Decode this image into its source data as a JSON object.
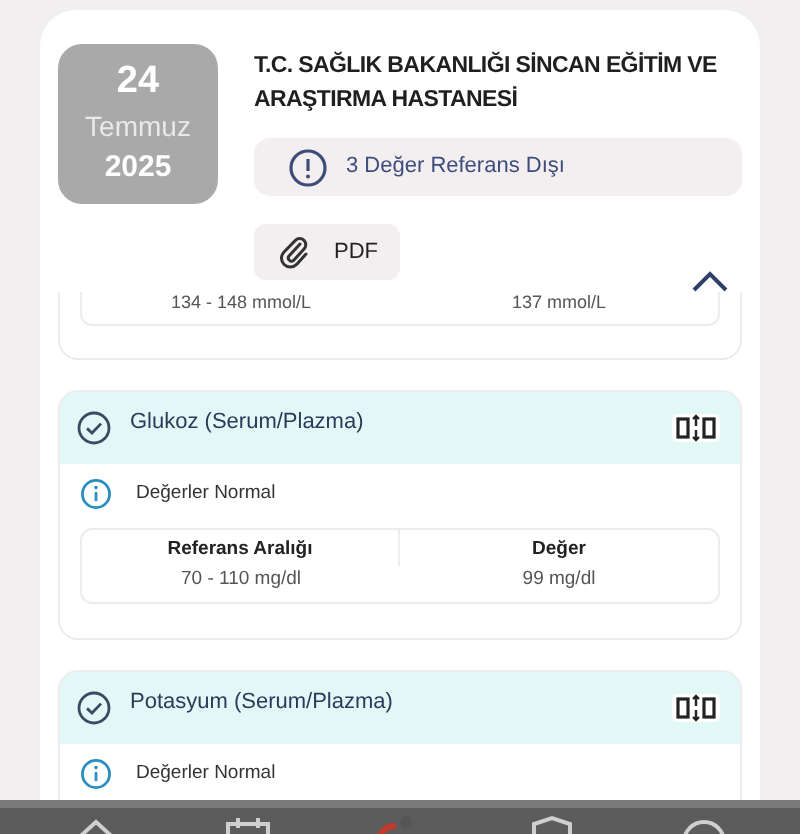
{
  "record": {
    "date": {
      "day": "24",
      "month": "Temmuz",
      "year": "2025"
    },
    "hospital": "T.C. SAĞLIK BAKANLIĞI SİNCAN EĞİTİM VE ARAŞTIRMA HASTANESİ",
    "alert": "3 Değer Referans Dışı",
    "attachment": "PDF",
    "expanded": true
  },
  "previous_result": {
    "range": "134 - 148 mmol/L",
    "value": "137 mmol/L"
  },
  "tests": [
    {
      "name": "Glukoz (Serum/Plazma)",
      "status": "Değerler Normal",
      "table": {
        "columns": [
          "Referans Aralığı",
          "Değer"
        ],
        "range": "70 - 110 mg/dl",
        "value": "99 mg/dl"
      }
    },
    {
      "name": "Potasyum (Serum/Plazma)",
      "status": "Değerler Normal"
    }
  ]
}
